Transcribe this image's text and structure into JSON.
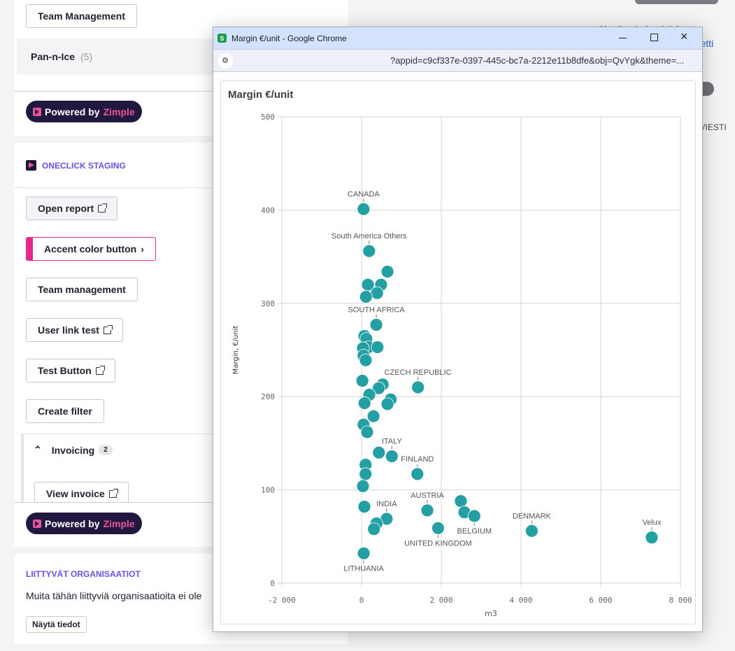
{
  "left": {
    "team_management_top": "Team Management",
    "group": {
      "name": "Pan-n-Ice",
      "count": "(5)"
    },
    "powered": {
      "prefix": "Powered by",
      "brand": "Zimple"
    },
    "section_title": "ONECLICK STAGING",
    "buttons": [
      "Open report",
      "Accent color button",
      "Team management",
      "User link test",
      "Test Button",
      "Create filter"
    ],
    "invoicing": {
      "label": "Invoicing",
      "count": "2",
      "button": "View invoice"
    },
    "related": {
      "title": "LIITTYVÄT ORGANISAATIOT",
      "text": "Muita tähän liittyviä organisaatioita ei ole",
      "button": "Näytä tiedot"
    },
    "accent_color": "#e8278a",
    "link_color": "#6b4fe0"
  },
  "right_fragments": [
    "Sinulla ei ole aktiviteet",
    "aktiviteetti",
    "TIVIESTI"
  ],
  "popup": {
    "title": "Margin €/unit - Google Chrome",
    "url": "?appid=c9cf337e-0397-445c-bc7a-2212e11b8dfe&obj=QvYgk&theme=...",
    "controls": [
      "minimize",
      "maximize",
      "close"
    ]
  },
  "chart_data": {
    "type": "scatter",
    "title": "Margin €/unit",
    "xlabel": "m3",
    "ylabel": "Margin, €/unit",
    "xlim": [
      -2000,
      8000
    ],
    "ylim": [
      0,
      500
    ],
    "xticks": [
      "-2 000",
      "0",
      "2 000",
      "4 000",
      "6 000",
      "8 000"
    ],
    "yticks": [
      "0",
      "100",
      "200",
      "300",
      "400",
      "500"
    ],
    "grid": true,
    "color": "#24a0a4",
    "points": [
      {
        "x": 50,
        "y": 401,
        "label": "CANADA"
      },
      {
        "x": 190,
        "y": 356,
        "label": "South America Others"
      },
      {
        "x": 650,
        "y": 334
      },
      {
        "x": 490,
        "y": 320
      },
      {
        "x": 160,
        "y": 320
      },
      {
        "x": 390,
        "y": 311
      },
      {
        "x": 110,
        "y": 307
      },
      {
        "x": 370,
        "y": 277,
        "label": "SOUTH AFRICA"
      },
      {
        "x": 70,
        "y": 265
      },
      {
        "x": 120,
        "y": 262
      },
      {
        "x": 175,
        "y": 253
      },
      {
        "x": 400,
        "y": 253
      },
      {
        "x": 35,
        "y": 252
      },
      {
        "x": 50,
        "y": 244
      },
      {
        "x": 105,
        "y": 239
      },
      {
        "x": 20,
        "y": 217
      },
      {
        "x": 530,
        "y": 213
      },
      {
        "x": 430,
        "y": 209
      },
      {
        "x": 1415,
        "y": 210,
        "label": "CZECH REPUBLIC"
      },
      {
        "x": 195,
        "y": 202
      },
      {
        "x": 730,
        "y": 197
      },
      {
        "x": 75,
        "y": 193
      },
      {
        "x": 650,
        "y": 192
      },
      {
        "x": 300,
        "y": 179
      },
      {
        "x": 50,
        "y": 170
      },
      {
        "x": 140,
        "y": 162
      },
      {
        "x": 435,
        "y": 140
      },
      {
        "x": 760,
        "y": 136,
        "label": "ITALY"
      },
      {
        "x": 100,
        "y": 127
      },
      {
        "x": 100,
        "y": 117
      },
      {
        "x": 1400,
        "y": 117,
        "label": "FINLAND"
      },
      {
        "x": 35,
        "y": 104
      },
      {
        "x": 70,
        "y": 82
      },
      {
        "x": 630,
        "y": 69,
        "label": "INDIA"
      },
      {
        "x": 375,
        "y": 64
      },
      {
        "x": 310,
        "y": 58
      },
      {
        "x": 1650,
        "y": 78,
        "label": "AUSTRIA"
      },
      {
        "x": 2490,
        "y": 88
      },
      {
        "x": 2580,
        "y": 76
      },
      {
        "x": 2830,
        "y": 72,
        "label": "BELGIUM"
      },
      {
        "x": 1920,
        "y": 59,
        "label": "UNITED KINGDOM"
      },
      {
        "x": 4270,
        "y": 56,
        "label": "DENMARK"
      },
      {
        "x": 7280,
        "y": 49,
        "label": "Velux"
      },
      {
        "x": 55,
        "y": 32,
        "label": "LITHUANIA"
      }
    ]
  }
}
